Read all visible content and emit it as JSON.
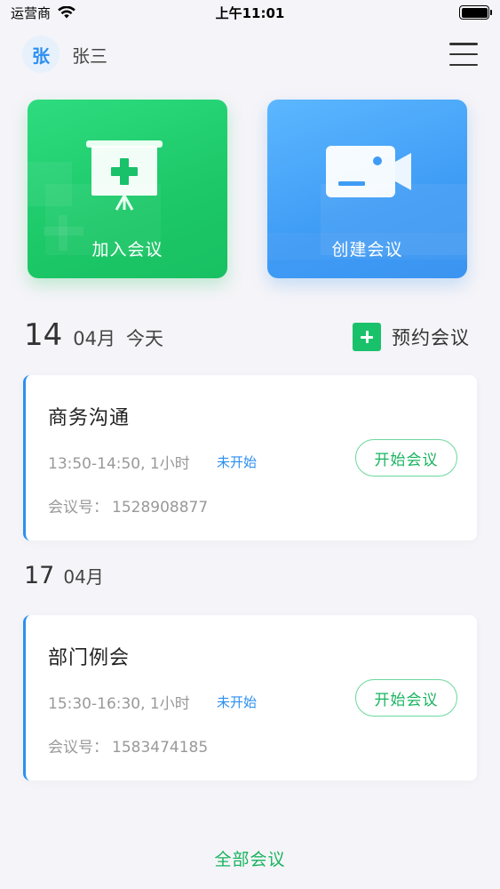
{
  "status_bar": {
    "carrier": "运营商",
    "time": "上午11:01",
    "battery_level": 1.0
  },
  "header": {
    "avatar_text": "张",
    "user_name": "张三",
    "menu_icon": "menu-icon"
  },
  "actions": {
    "join": {
      "label": "加入会议",
      "icon": "projector-plus-icon"
    },
    "create": {
      "label": "创建会议",
      "icon": "video-camera-icon"
    }
  },
  "groups": [
    {
      "day": "14",
      "month": "04月",
      "today_label": "今天",
      "meetings": [
        {
          "title": "商务沟通",
          "time": "13:50-14:50, 1小时",
          "status": "未开始",
          "id_label": "会议号：",
          "id_value": "1528908877",
          "start_label": "开始会议"
        }
      ]
    },
    {
      "day": "17",
      "month": "04月",
      "meetings": [
        {
          "title": "部门例会",
          "time": "15:30-16:30, 1小时",
          "status": "未开始",
          "id_label": "会议号：",
          "id_value": "1583474185",
          "start_label": "开始会议"
        }
      ]
    }
  ],
  "schedule_button": {
    "label": "预约会议",
    "icon": "plus-icon"
  },
  "footer": {
    "all_meetings_label": "全部会议"
  },
  "colors": {
    "accent_blue": "#2c8ff0",
    "accent_green": "#19c16a",
    "join_card": "#1cc868",
    "create_card": "#3f9cf5",
    "background": "#f5f4f8"
  }
}
